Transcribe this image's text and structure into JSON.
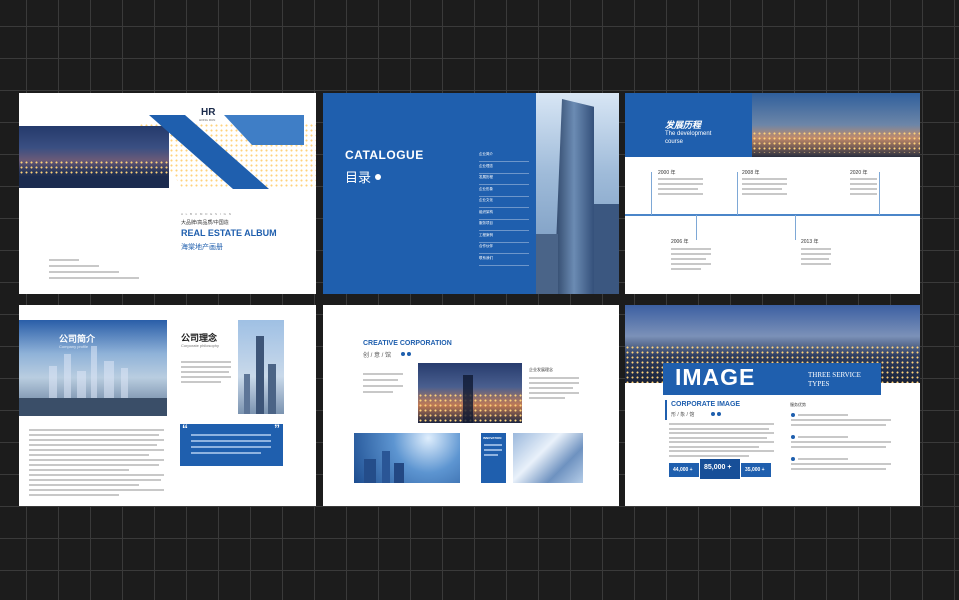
{
  "page1": {
    "logo": "HR",
    "logo_sub": "HONG RUN",
    "spaced": "A L B U M   D E S I G N",
    "tagline": "大品牌/高品质/中国造",
    "title_en": "REAL ESTATE ALBUM",
    "title_cn": "海棠地产画册"
  },
  "page2": {
    "title_en": "CATALOGUE",
    "title_cn": "目录",
    "items": [
      "企业简介",
      "企业理念",
      "发展历程",
      "企业形象",
      "企业文化",
      "组织架构",
      "服务项目",
      "工程案例",
      "合作伙伴",
      "联系我们"
    ]
  },
  "page3": {
    "title_cn": "发展历程",
    "title_en_1": "The development",
    "title_en_2": "course",
    "years_top": [
      "2000 年",
      "2008 年",
      "2020 年"
    ],
    "years_bottom": [
      "2006 年",
      "2013 年"
    ]
  },
  "page4": {
    "left_title": "公司简介",
    "left_sub": "Company profile",
    "right_title": "公司理念",
    "right_sub": "Corporate philosophy",
    "quote_open": "“",
    "quote_close": "”"
  },
  "page5": {
    "title_en": "CREATIVE CORPORATION",
    "title_cn": "创 / 意 / 馆",
    "sub_right": "企业发展理念",
    "innovation": "INNOVATION"
  },
  "page6": {
    "big": "IMAGE",
    "service_1": "THREE SERVICE",
    "service_2": "TYPES",
    "corp_image": "CORPORATE IMAGE",
    "corp_cn": "形 / 象 / 馆",
    "right_head": "服务优势",
    "stats": [
      "44,000 +",
      "85,000 +",
      "35,000 +"
    ]
  },
  "colors": {
    "brand_blue": "#1f5fae",
    "background": "#1c1c1c"
  }
}
